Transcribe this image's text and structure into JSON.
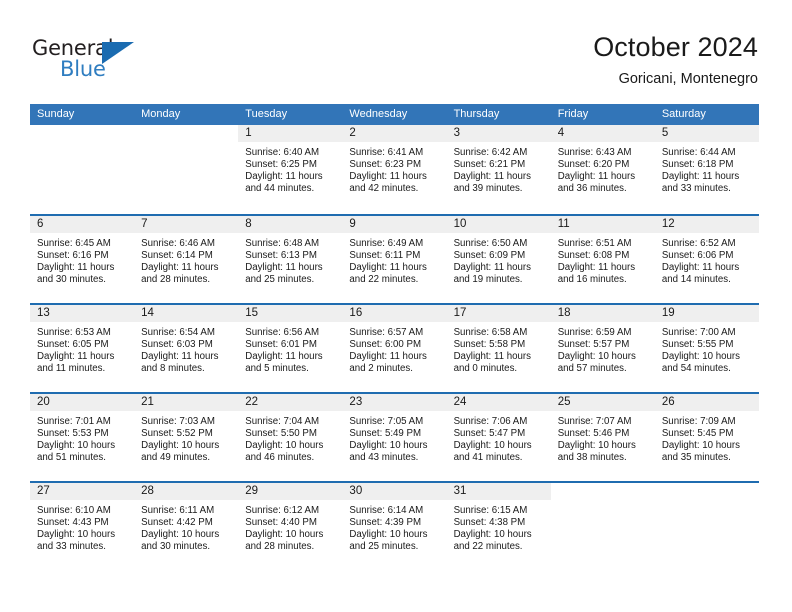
{
  "logo": {
    "word_one": "General",
    "word_two": "Blue",
    "mark": "triangle-mark"
  },
  "header": {
    "title": "October 2024",
    "subtitle": "Goricani, Montenegro"
  },
  "colors": {
    "header_blue": "#3275b8",
    "divider_blue": "#1f6cb0",
    "date_band": "#efefef",
    "logo_blue": "#2f7dc0"
  },
  "calendar": {
    "weekday_headers": [
      "Sunday",
      "Monday",
      "Tuesday",
      "Wednesday",
      "Thursday",
      "Friday",
      "Saturday"
    ],
    "weeks": [
      [
        {
          "day": "",
          "sunrise": "",
          "sunset": "",
          "daylight": "",
          "daylight2": "",
          "blank": true
        },
        {
          "day": "",
          "sunrise": "",
          "sunset": "",
          "daylight": "",
          "daylight2": "",
          "blank": true
        },
        {
          "day": "1",
          "sunrise": "Sunrise: 6:40 AM",
          "sunset": "Sunset: 6:25 PM",
          "daylight": "Daylight: 11 hours",
          "daylight2": "and 44 minutes."
        },
        {
          "day": "2",
          "sunrise": "Sunrise: 6:41 AM",
          "sunset": "Sunset: 6:23 PM",
          "daylight": "Daylight: 11 hours",
          "daylight2": "and 42 minutes."
        },
        {
          "day": "3",
          "sunrise": "Sunrise: 6:42 AM",
          "sunset": "Sunset: 6:21 PM",
          "daylight": "Daylight: 11 hours",
          "daylight2": "and 39 minutes."
        },
        {
          "day": "4",
          "sunrise": "Sunrise: 6:43 AM",
          "sunset": "Sunset: 6:20 PM",
          "daylight": "Daylight: 11 hours",
          "daylight2": "and 36 minutes."
        },
        {
          "day": "5",
          "sunrise": "Sunrise: 6:44 AM",
          "sunset": "Sunset: 6:18 PM",
          "daylight": "Daylight: 11 hours",
          "daylight2": "and 33 minutes."
        }
      ],
      [
        {
          "day": "6",
          "sunrise": "Sunrise: 6:45 AM",
          "sunset": "Sunset: 6:16 PM",
          "daylight": "Daylight: 11 hours",
          "daylight2": "and 30 minutes."
        },
        {
          "day": "7",
          "sunrise": "Sunrise: 6:46 AM",
          "sunset": "Sunset: 6:14 PM",
          "daylight": "Daylight: 11 hours",
          "daylight2": "and 28 minutes."
        },
        {
          "day": "8",
          "sunrise": "Sunrise: 6:48 AM",
          "sunset": "Sunset: 6:13 PM",
          "daylight": "Daylight: 11 hours",
          "daylight2": "and 25 minutes."
        },
        {
          "day": "9",
          "sunrise": "Sunrise: 6:49 AM",
          "sunset": "Sunset: 6:11 PM",
          "daylight": "Daylight: 11 hours",
          "daylight2": "and 22 minutes."
        },
        {
          "day": "10",
          "sunrise": "Sunrise: 6:50 AM",
          "sunset": "Sunset: 6:09 PM",
          "daylight": "Daylight: 11 hours",
          "daylight2": "and 19 minutes."
        },
        {
          "day": "11",
          "sunrise": "Sunrise: 6:51 AM",
          "sunset": "Sunset: 6:08 PM",
          "daylight": "Daylight: 11 hours",
          "daylight2": "and 16 minutes."
        },
        {
          "day": "12",
          "sunrise": "Sunrise: 6:52 AM",
          "sunset": "Sunset: 6:06 PM",
          "daylight": "Daylight: 11 hours",
          "daylight2": "and 14 minutes."
        }
      ],
      [
        {
          "day": "13",
          "sunrise": "Sunrise: 6:53 AM",
          "sunset": "Sunset: 6:05 PM",
          "daylight": "Daylight: 11 hours",
          "daylight2": "and 11 minutes."
        },
        {
          "day": "14",
          "sunrise": "Sunrise: 6:54 AM",
          "sunset": "Sunset: 6:03 PM",
          "daylight": "Daylight: 11 hours",
          "daylight2": "and 8 minutes."
        },
        {
          "day": "15",
          "sunrise": "Sunrise: 6:56 AM",
          "sunset": "Sunset: 6:01 PM",
          "daylight": "Daylight: 11 hours",
          "daylight2": "and 5 minutes."
        },
        {
          "day": "16",
          "sunrise": "Sunrise: 6:57 AM",
          "sunset": "Sunset: 6:00 PM",
          "daylight": "Daylight: 11 hours",
          "daylight2": "and 2 minutes."
        },
        {
          "day": "17",
          "sunrise": "Sunrise: 6:58 AM",
          "sunset": "Sunset: 5:58 PM",
          "daylight": "Daylight: 11 hours",
          "daylight2": "and 0 minutes."
        },
        {
          "day": "18",
          "sunrise": "Sunrise: 6:59 AM",
          "sunset": "Sunset: 5:57 PM",
          "daylight": "Daylight: 10 hours",
          "daylight2": "and 57 minutes."
        },
        {
          "day": "19",
          "sunrise": "Sunrise: 7:00 AM",
          "sunset": "Sunset: 5:55 PM",
          "daylight": "Daylight: 10 hours",
          "daylight2": "and 54 minutes."
        }
      ],
      [
        {
          "day": "20",
          "sunrise": "Sunrise: 7:01 AM",
          "sunset": "Sunset: 5:53 PM",
          "daylight": "Daylight: 10 hours",
          "daylight2": "and 51 minutes."
        },
        {
          "day": "21",
          "sunrise": "Sunrise: 7:03 AM",
          "sunset": "Sunset: 5:52 PM",
          "daylight": "Daylight: 10 hours",
          "daylight2": "and 49 minutes."
        },
        {
          "day": "22",
          "sunrise": "Sunrise: 7:04 AM",
          "sunset": "Sunset: 5:50 PM",
          "daylight": "Daylight: 10 hours",
          "daylight2": "and 46 minutes."
        },
        {
          "day": "23",
          "sunrise": "Sunrise: 7:05 AM",
          "sunset": "Sunset: 5:49 PM",
          "daylight": "Daylight: 10 hours",
          "daylight2": "and 43 minutes."
        },
        {
          "day": "24",
          "sunrise": "Sunrise: 7:06 AM",
          "sunset": "Sunset: 5:47 PM",
          "daylight": "Daylight: 10 hours",
          "daylight2": "and 41 minutes."
        },
        {
          "day": "25",
          "sunrise": "Sunrise: 7:07 AM",
          "sunset": "Sunset: 5:46 PM",
          "daylight": "Daylight: 10 hours",
          "daylight2": "and 38 minutes."
        },
        {
          "day": "26",
          "sunrise": "Sunrise: 7:09 AM",
          "sunset": "Sunset: 5:45 PM",
          "daylight": "Daylight: 10 hours",
          "daylight2": "and 35 minutes."
        }
      ],
      [
        {
          "day": "27",
          "sunrise": "Sunrise: 6:10 AM",
          "sunset": "Sunset: 4:43 PM",
          "daylight": "Daylight: 10 hours",
          "daylight2": "and 33 minutes."
        },
        {
          "day": "28",
          "sunrise": "Sunrise: 6:11 AM",
          "sunset": "Sunset: 4:42 PM",
          "daylight": "Daylight: 10 hours",
          "daylight2": "and 30 minutes."
        },
        {
          "day": "29",
          "sunrise": "Sunrise: 6:12 AM",
          "sunset": "Sunset: 4:40 PM",
          "daylight": "Daylight: 10 hours",
          "daylight2": "and 28 minutes."
        },
        {
          "day": "30",
          "sunrise": "Sunrise: 6:14 AM",
          "sunset": "Sunset: 4:39 PM",
          "daylight": "Daylight: 10 hours",
          "daylight2": "and 25 minutes."
        },
        {
          "day": "31",
          "sunrise": "Sunrise: 6:15 AM",
          "sunset": "Sunset: 4:38 PM",
          "daylight": "Daylight: 10 hours",
          "daylight2": "and 22 minutes."
        },
        {
          "day": "",
          "sunrise": "",
          "sunset": "",
          "daylight": "",
          "daylight2": "",
          "blank": true
        },
        {
          "day": "",
          "sunrise": "",
          "sunset": "",
          "daylight": "",
          "daylight2": "",
          "blank": true
        }
      ]
    ]
  }
}
